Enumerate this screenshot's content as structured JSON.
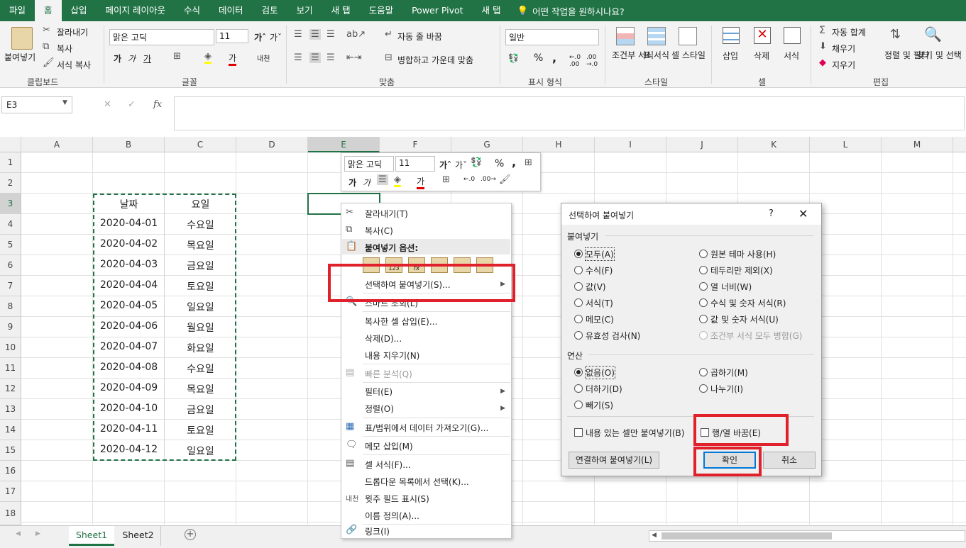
{
  "ribbon_tabs": [
    "파일",
    "홈",
    "삽입",
    "페이지 레이아웃",
    "수식",
    "데이터",
    "검토",
    "보기",
    "새 탭",
    "도움말",
    "Power Pivot",
    "새 탭"
  ],
  "active_tab": "홈",
  "tell_me": "어떤 작업을 원하시나요?",
  "clipboard": {
    "paste": "붙여넣기",
    "cut": "잘라내기",
    "copy": "복사",
    "format_painter": "서식 복사",
    "label": "클립보드"
  },
  "font": {
    "name": "맑은 고딕",
    "size": "11",
    "label": "글꼴",
    "phonetic": "내천"
  },
  "alignment": {
    "wrap": "자동 줄 바꿈",
    "merge": "병합하고 가운데 맞춤",
    "label": "맞춤"
  },
  "number": {
    "format": "일반",
    "label": "표시 형식"
  },
  "styles": {
    "conditional": "조건부 서식",
    "table": "표 서식",
    "cell": "셀 스타일",
    "label": "스타일"
  },
  "cells": {
    "insert": "삽입",
    "delete": "삭제",
    "format": "서식",
    "label": "셀"
  },
  "editing": {
    "autosum": "자동 합계",
    "fill": "채우기",
    "clear": "지우기",
    "sort": "정렬 및 필터",
    "find": "찾기 및 선택",
    "label": "편집"
  },
  "name_box": "E3",
  "columns": [
    "A",
    "B",
    "C",
    "D",
    "E",
    "F",
    "G",
    "H",
    "I",
    "J",
    "K",
    "L",
    "M"
  ],
  "rows": [
    "1",
    "2",
    "3",
    "4",
    "5",
    "6",
    "7",
    "8",
    "9",
    "10",
    "11",
    "12",
    "13",
    "14",
    "15",
    "16",
    "17",
    "18"
  ],
  "table": {
    "headers": [
      "날짜",
      "요일"
    ],
    "rows": [
      [
        "2020-04-01",
        "수요일"
      ],
      [
        "2020-04-02",
        "목요일"
      ],
      [
        "2020-04-03",
        "금요일"
      ],
      [
        "2020-04-04",
        "토요일"
      ],
      [
        "2020-04-05",
        "일요일"
      ],
      [
        "2020-04-06",
        "월요일"
      ],
      [
        "2020-04-07",
        "화요일"
      ],
      [
        "2020-04-08",
        "수요일"
      ],
      [
        "2020-04-09",
        "목요일"
      ],
      [
        "2020-04-10",
        "금요일"
      ],
      [
        "2020-04-11",
        "토요일"
      ],
      [
        "2020-04-12",
        "일요일"
      ]
    ]
  },
  "mini_toolbar": {
    "font": "맑은 고딕",
    "size": "11"
  },
  "context_menu": {
    "cut": "잘라내기(T)",
    "copy": "복사(C)",
    "paste_options": "붙여넣기 옵션:",
    "paste_special": "선택하여 붙여넣기(S)...",
    "smart_lookup": "스마트 조회(L)",
    "insert_copied": "복사한 셀 삽입(E)...",
    "delete": "삭제(D)...",
    "clear": "내용 지우기(N)",
    "quick_analysis": "빠른 분석(Q)",
    "filter": "필터(E)",
    "sort": "정렬(O)",
    "get_data": "표/범위에서 데이터 가져오기(G)...",
    "insert_comment": "메모 삽입(M)",
    "format_cells": "셀 서식(F)...",
    "pick_list": "드롭다운 목록에서 선택(K)...",
    "phonetic": "윗주 필드 표시(S)",
    "define_name": "이름 정의(A)...",
    "link": "링크(I)"
  },
  "dialog": {
    "title": "선택하여 붙여넣기",
    "help": "?",
    "paste_section": "붙여넣기",
    "paste_options_left": [
      "모두(A)",
      "수식(F)",
      "값(V)",
      "서식(T)",
      "메모(C)",
      "유효성 검사(N)"
    ],
    "paste_options_right": [
      "원본 테마 사용(H)",
      "테두리만 제외(X)",
      "열 너비(W)",
      "수식 및 숫자 서식(R)",
      "값 및 숫자 서식(U)",
      "조건부 서식 모두 병합(G)"
    ],
    "operation_section": "연산",
    "operations_left": [
      "없음(O)",
      "더하기(D)",
      "빼기(S)"
    ],
    "operations_right": [
      "곱하기(M)",
      "나누기(I)"
    ],
    "skip_blanks": "내용 있는 셀만 붙여넣기(B)",
    "transpose": "행/열 바꿈(E)",
    "paste_link": "연결하여 붙여넣기(L)",
    "ok": "확인",
    "cancel": "취소"
  },
  "sheets": [
    "Sheet1",
    "Sheet2"
  ],
  "active_sheet": "Sheet1",
  "colors": {
    "excel_green": "#217346",
    "highlight_red": "#e0202a"
  }
}
